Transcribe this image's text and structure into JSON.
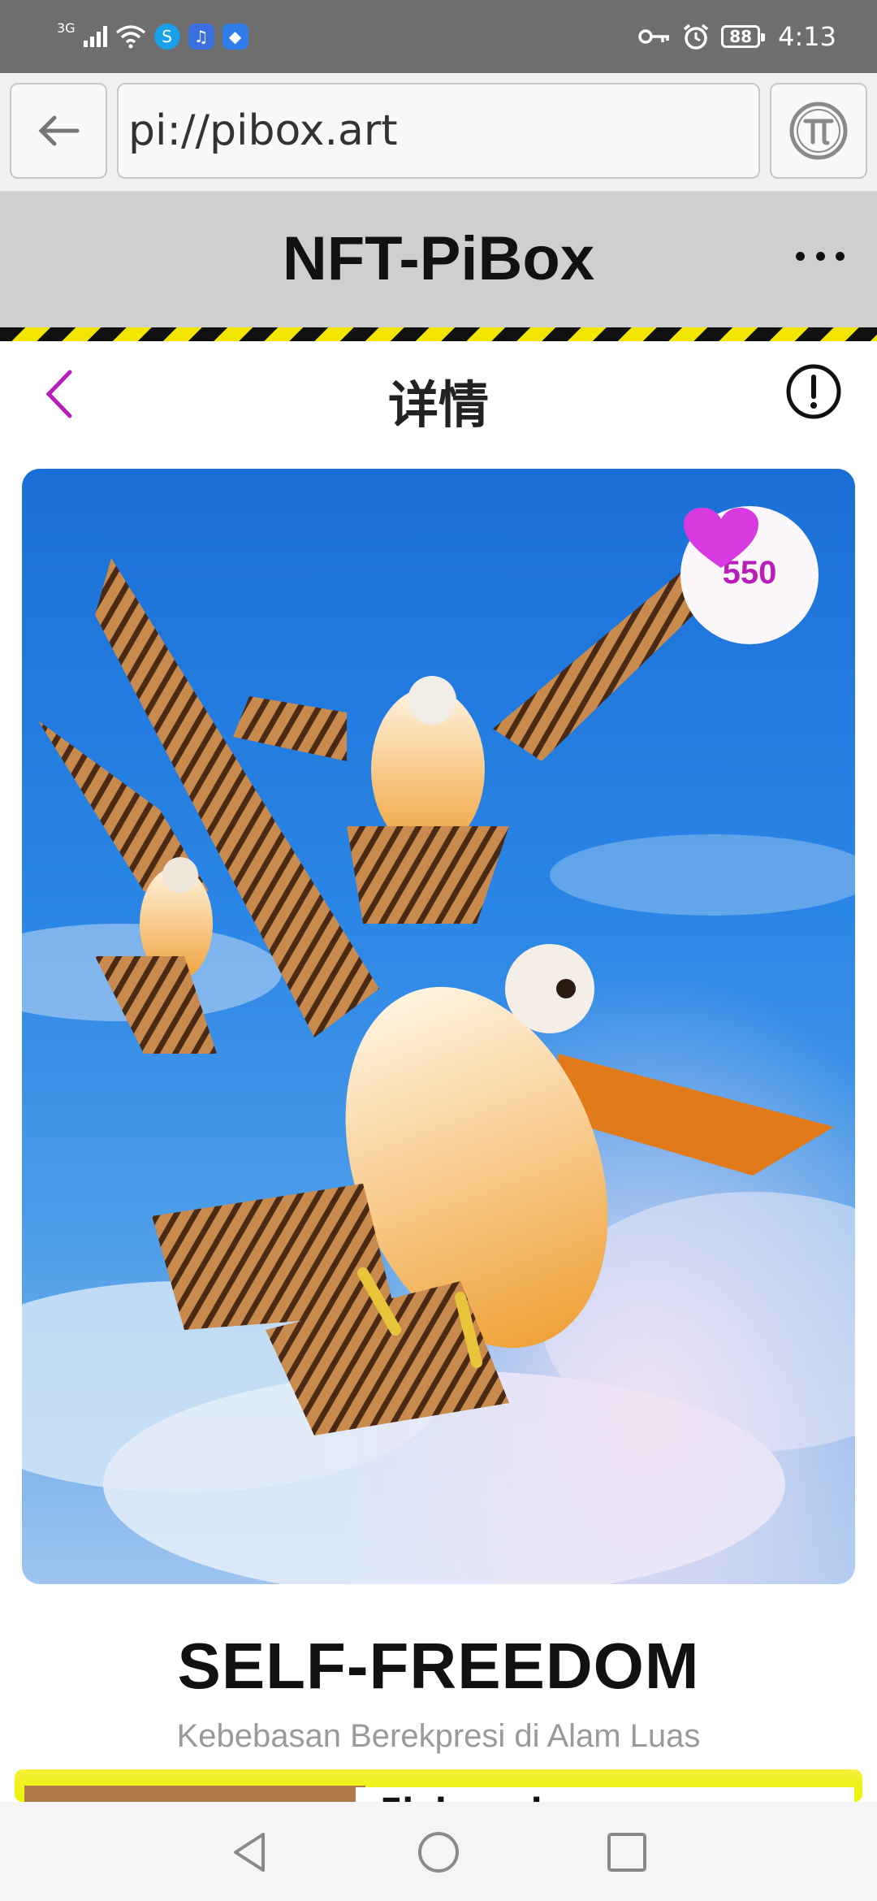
{
  "status_bar": {
    "network": "3G",
    "battery": "88",
    "time": "4:13"
  },
  "browser": {
    "url": "pi://pibox.art"
  },
  "app": {
    "title": "NFT-PiBox"
  },
  "nav": {
    "title": "详情"
  },
  "nft": {
    "likes": "550",
    "title": "SELF-FREEDOM",
    "subtitle": "Kebebasan Berekpresi di Alam Luas"
  },
  "next_card": {
    "title_partial": "Elaborada"
  },
  "colors": {
    "accent_purple": "#b81fb8",
    "heart": "#d93adf",
    "header_bg": "#cfcfcf",
    "hazard_yellow": "#f2e600"
  }
}
